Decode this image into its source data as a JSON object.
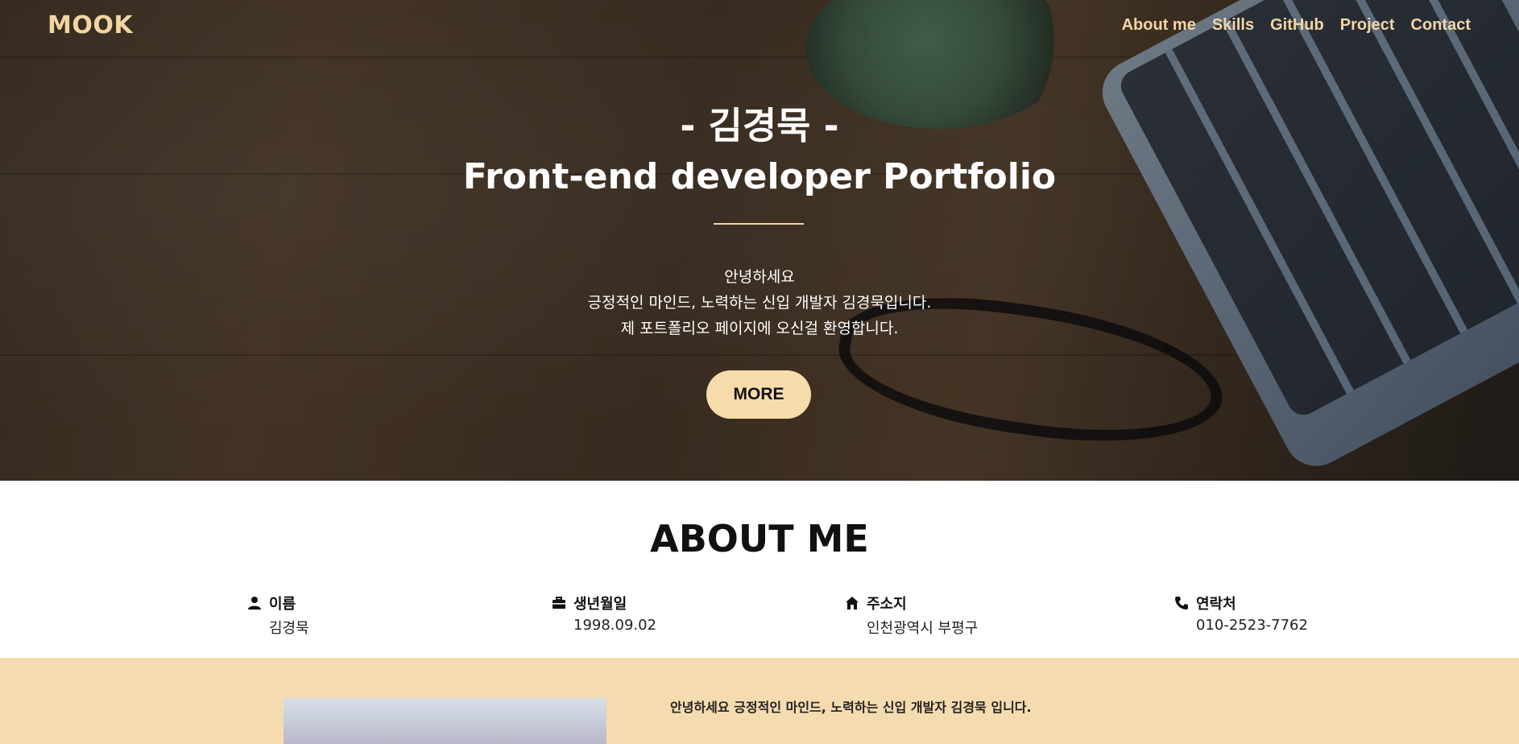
{
  "header": {
    "logo": "MOOK",
    "nav": [
      "About me",
      "Skills",
      "GitHub",
      "Project",
      "Contact"
    ]
  },
  "hero": {
    "name": "- 김경묵 -",
    "title": "Front-end developer Portfolio",
    "intro": [
      "안녕하세요",
      "긍정적인 마인드, 노력하는 신입 개발자 김경묵입니다.",
      "제 포트폴리오 페이지에 오신걸 환영합니다."
    ],
    "more_label": "MORE"
  },
  "about": {
    "title": "ABOUT ME",
    "items": [
      {
        "icon": "user-icon",
        "label": "이름",
        "value": "김경묵"
      },
      {
        "icon": "briefcase-icon",
        "label": "생년월일",
        "value": "1998.09.02"
      },
      {
        "icon": "home-icon",
        "label": "주소지",
        "value": "인천광역시 부평구"
      },
      {
        "icon": "phone-icon",
        "label": "연락처",
        "value": "010-2523-7762"
      }
    ],
    "intro_text": "안녕하세요 긍정적인 마인드, 노력하는 신입 개발자 김경묵 입니다."
  },
  "colors": {
    "accent": "#f1d6a4",
    "button": "#f6dcaa",
    "about_band": "#f5dcb0"
  }
}
